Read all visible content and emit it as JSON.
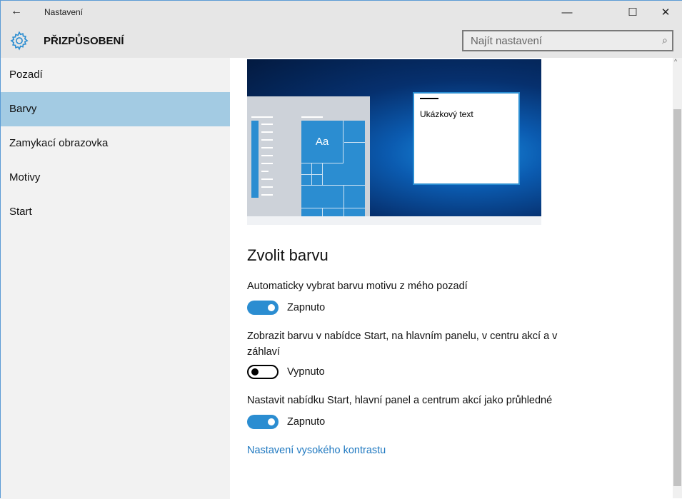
{
  "window": {
    "title": "Nastavení",
    "minimize": "—",
    "maximize": "☐",
    "close": "✕",
    "back": "←"
  },
  "header": {
    "title": "PŘIZPŮSOBENÍ",
    "search_placeholder": "Najít nastavení",
    "search_icon": "⌕"
  },
  "sidebar": {
    "items": [
      {
        "label": "Pozadí"
      },
      {
        "label": "Barvy"
      },
      {
        "label": "Zamykací obrazovka"
      },
      {
        "label": "Motivy"
      },
      {
        "label": "Start"
      }
    ],
    "selected": "Barvy"
  },
  "preview": {
    "tile_label": "Aa",
    "sample_text": "Ukázkový text"
  },
  "main": {
    "heading": "Zvolit barvu",
    "settings": [
      {
        "label": "Automaticky vybrat barvu motivu z mého pozadí",
        "state": "Zapnuto",
        "on": true
      },
      {
        "label": "Zobrazit barvu v nabídce Start, na hlavním panelu, v centru akcí a v záhlaví",
        "state": "Vypnuto",
        "on": false
      },
      {
        "label": "Nastavit nabídku Start, hlavní panel a centrum akcí jako průhledné",
        "state": "Zapnuto",
        "on": true
      }
    ],
    "link": "Nastavení vysokého kontrastu"
  },
  "colors": {
    "accent": "#2b8dd1",
    "selected": "#a3cbe3"
  }
}
